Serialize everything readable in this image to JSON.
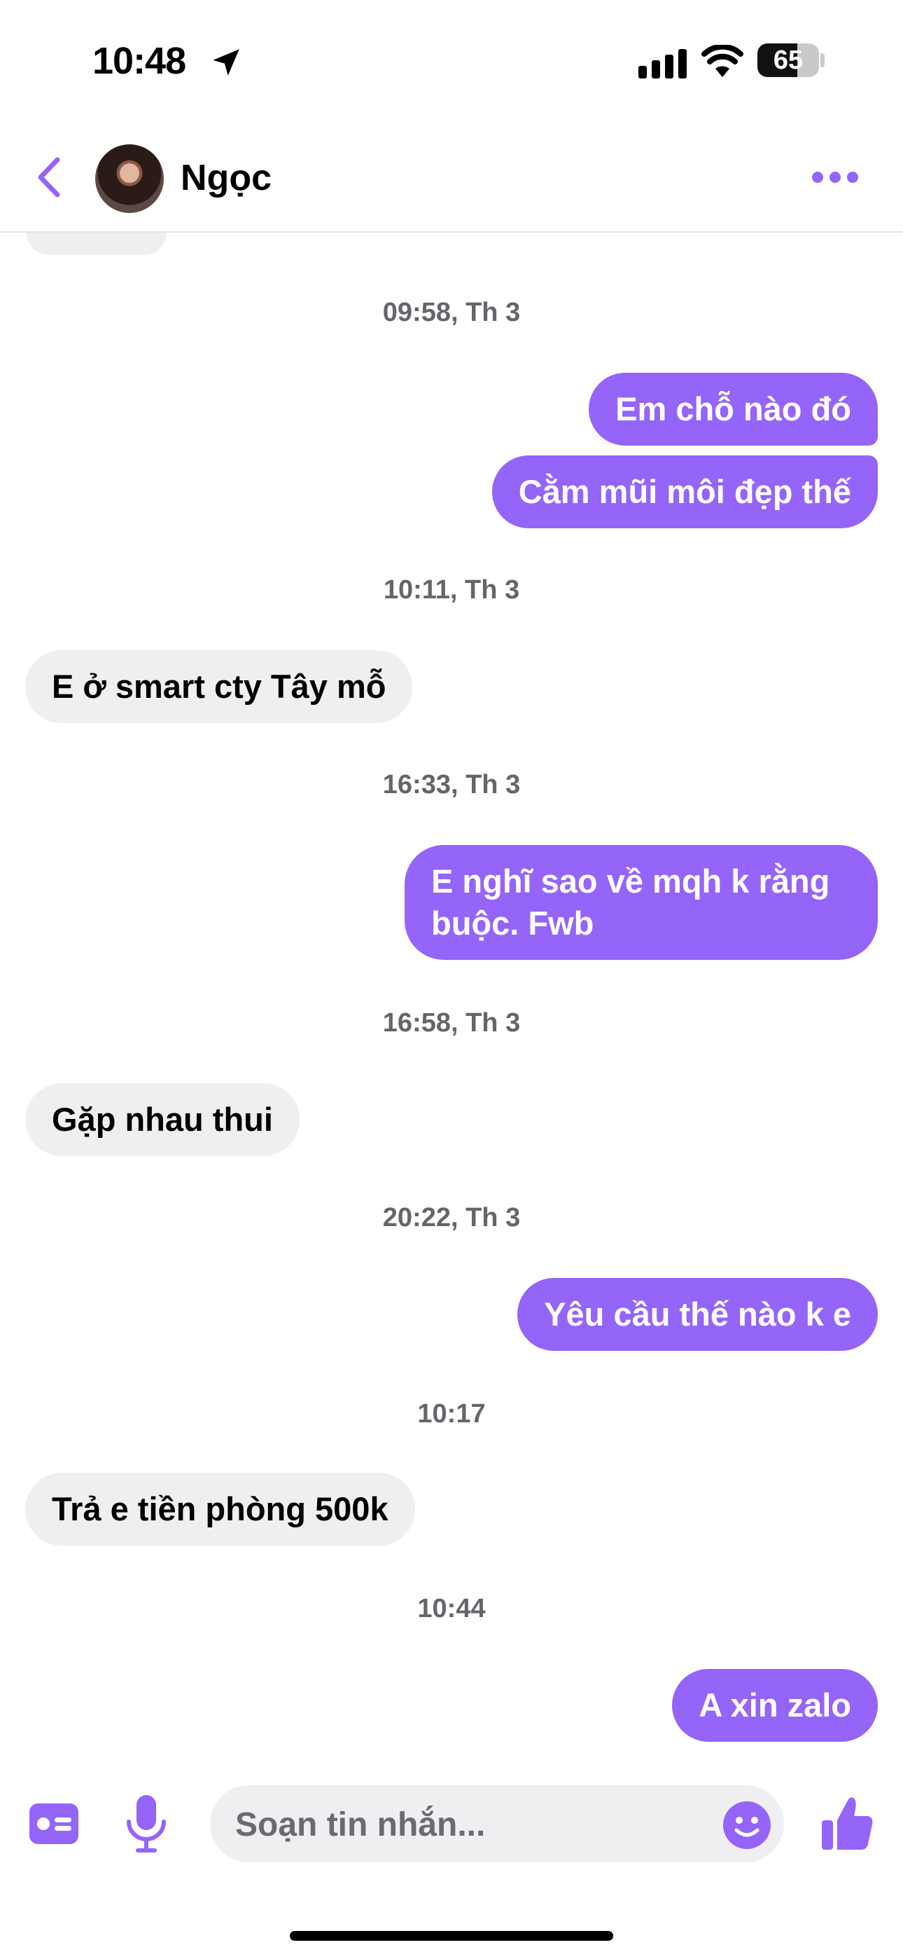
{
  "status_bar": {
    "time": "10:48",
    "battery": "65",
    "battery_level": 0.65,
    "icons": [
      "location-arrow-icon",
      "cellular-signal-icon",
      "wifi-icon",
      "battery-icon"
    ]
  },
  "header": {
    "contact_name": "Ngọc",
    "icons": [
      "back-chevron-icon",
      "avatar",
      "more-options-icon"
    ]
  },
  "conversation": {
    "timestamps": [
      "09:58, Th 3",
      "10:11, Th 3",
      "16:33, Th 3",
      "16:58, Th 3",
      "20:22, Th 3",
      "10:17",
      "10:44"
    ],
    "messages": [
      {
        "direction": "outgoing",
        "text": "Em chỗ nào đó"
      },
      {
        "direction": "outgoing",
        "text": "Cằm mũi môi đẹp thế"
      },
      {
        "direction": "incoming",
        "text": "E ở smart cty Tây mỗ"
      },
      {
        "direction": "outgoing",
        "text": "E nghĩ sao về mqh k rằng buộc. Fwb"
      },
      {
        "direction": "incoming",
        "text": "Gặp nhau thui"
      },
      {
        "direction": "outgoing",
        "text": "Yêu cầu thế nào k e"
      },
      {
        "direction": "incoming",
        "text": "Trả e tiền phòng 500k"
      },
      {
        "direction": "outgoing",
        "text": "A xin zalo"
      }
    ]
  },
  "composer": {
    "placeholder": "Soạn tin nhắn...",
    "value": "",
    "icons": [
      "contact-card-icon",
      "microphone-icon",
      "emoji-icon",
      "thumbs-up-icon"
    ]
  },
  "colors": {
    "accent": "#9564f9",
    "incoming_bubble": "#efefef",
    "timestamp_text": "#65656b"
  }
}
